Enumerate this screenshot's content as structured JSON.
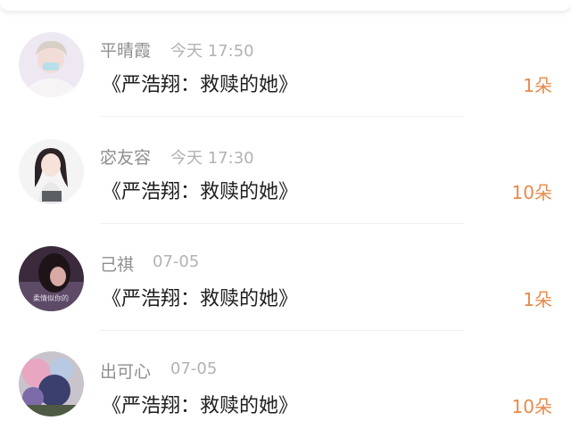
{
  "messages": [
    {
      "name": "平晴霞",
      "time": "今天 17:50",
      "title": "《严浩翔：救赎的她》",
      "count": "1朵"
    },
    {
      "name": "宓友容",
      "time": "今天 17:30",
      "title": "《严浩翔：救赎的她》",
      "count": "10朵"
    },
    {
      "name": "己祺",
      "time": "07-05",
      "title": "《严浩翔：救赎的她》",
      "count": "1朵"
    },
    {
      "name": "出可心",
      "time": "07-05",
      "title": "《严浩翔：救赎的她》",
      "count": "10朵"
    }
  ],
  "avatar_watermark": "柔情似你的",
  "colors": {
    "count_accent": "#e8894a",
    "name_gray": "#8e8e8e",
    "time_gray": "#b2b2b2",
    "title_dark": "#1e1e1e"
  }
}
